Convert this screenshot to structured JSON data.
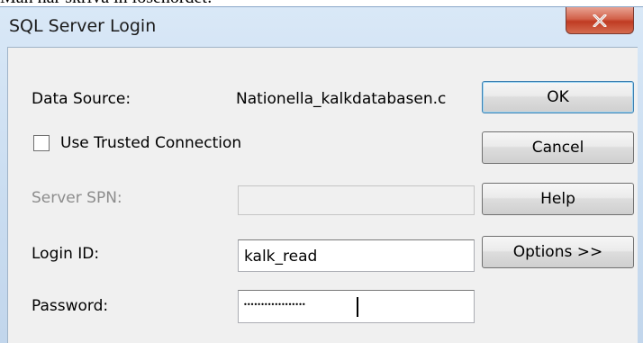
{
  "background_text": "Man har skriva in lösenordet:",
  "dialog": {
    "title": "SQL Server Login",
    "close_label": "X"
  },
  "form": {
    "data_source_label": "Data Source:",
    "data_source_value": "Nationella_kalkdatabasen.c",
    "trusted_label": "Use Trusted Connection",
    "trusted_checked": false,
    "spn_label": "Server SPN:",
    "spn_value": "",
    "login_label": "Login ID:",
    "login_value": "kalk_read",
    "password_label": "Password:",
    "password_mask": "••••••••••••••••••"
  },
  "buttons": {
    "ok": "OK",
    "cancel": "Cancel",
    "help": "Help",
    "options": "Options >>"
  },
  "colors": {
    "titlebar": "#c9dcf0",
    "close_button": "#c7442b",
    "client_bg": "#f0f0f0",
    "default_button_border": "#3c7fb1"
  }
}
